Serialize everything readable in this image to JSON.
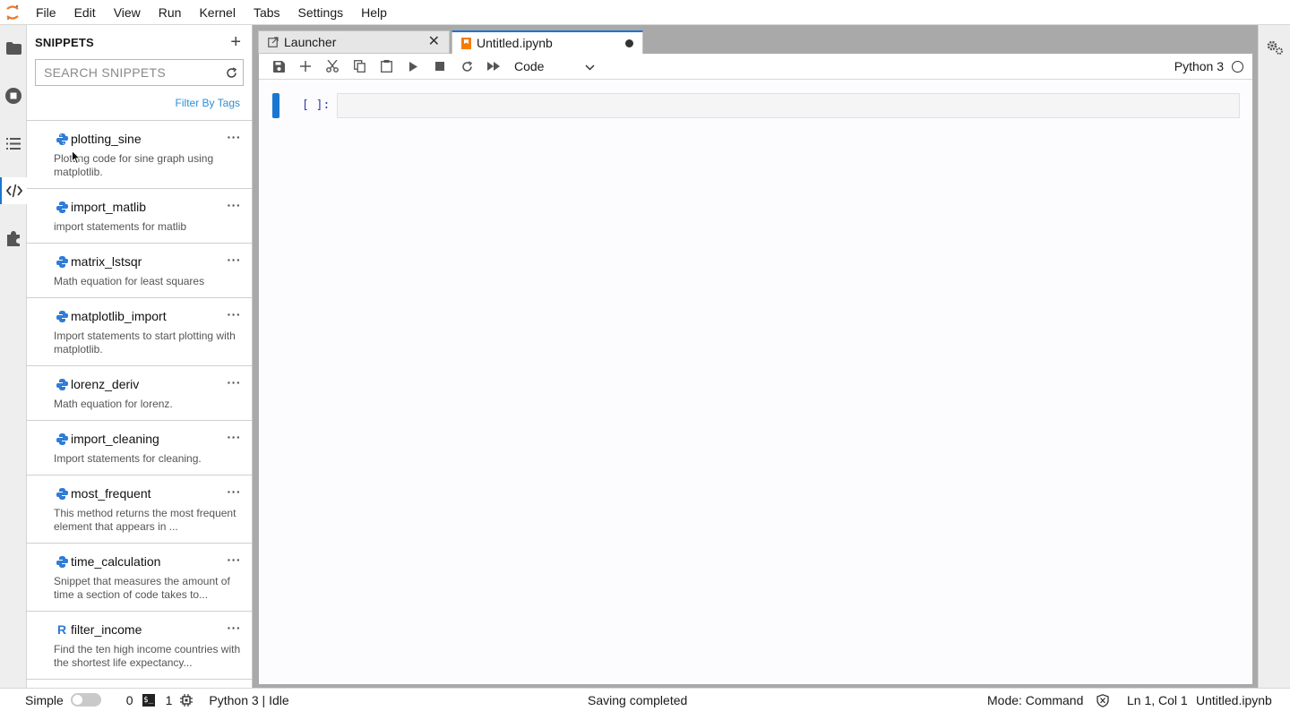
{
  "menubar": {
    "items": [
      "File",
      "Edit",
      "View",
      "Run",
      "Kernel",
      "Tabs",
      "Settings",
      "Help"
    ]
  },
  "sidebar": {
    "title": "SNIPPETS",
    "add_icon": "plus-icon",
    "search_placeholder": "SEARCH SNIPPETS",
    "filter_label": "Filter By Tags",
    "snippets": [
      {
        "name": "plotting_sine",
        "lang": "python",
        "desc": "Plotting code for sine graph using matplotlib."
      },
      {
        "name": "import_matlib",
        "lang": "python",
        "desc": "import statements for matlib"
      },
      {
        "name": "matrix_lstsqr",
        "lang": "python",
        "desc": "Math equation for least squares"
      },
      {
        "name": "matplotlib_import",
        "lang": "python",
        "desc": "Import statements to start plotting with matplotlib."
      },
      {
        "name": "lorenz_deriv",
        "lang": "python",
        "desc": "Math equation for lorenz."
      },
      {
        "name": "import_cleaning",
        "lang": "python",
        "desc": "Import statements for cleaning."
      },
      {
        "name": "most_frequent",
        "lang": "python",
        "desc": "This method returns the most frequent element that appears in ..."
      },
      {
        "name": "time_calculation",
        "lang": "python",
        "desc": "Snippet that measures the amount of time a section of code takes to..."
      },
      {
        "name": "filter_income",
        "lang": "R",
        "desc": "Find the ten high income countries with the shortest life expectancy..."
      }
    ]
  },
  "tabs": [
    {
      "label": "Launcher",
      "icon": "launcher-icon",
      "active": false
    },
    {
      "label": "Untitled.ipynb",
      "icon": "notebook-icon",
      "active": true
    }
  ],
  "toolbar": {
    "cell_type": "Code",
    "kernel_name": "Python 3"
  },
  "cell": {
    "prompt": "[ ]:"
  },
  "statusbar": {
    "mode_label": "Simple",
    "terminals": "0",
    "kernels": "1",
    "kernel_status": "Python 3 | Idle",
    "message": "Saving completed",
    "mode": "Mode: Command",
    "position": "Ln 1, Col 1",
    "file": "Untitled.ipynb"
  },
  "colors": {
    "accent": "#1976d2",
    "python_blue": "#2e7bd6",
    "notebook_orange": "#f57c00"
  }
}
